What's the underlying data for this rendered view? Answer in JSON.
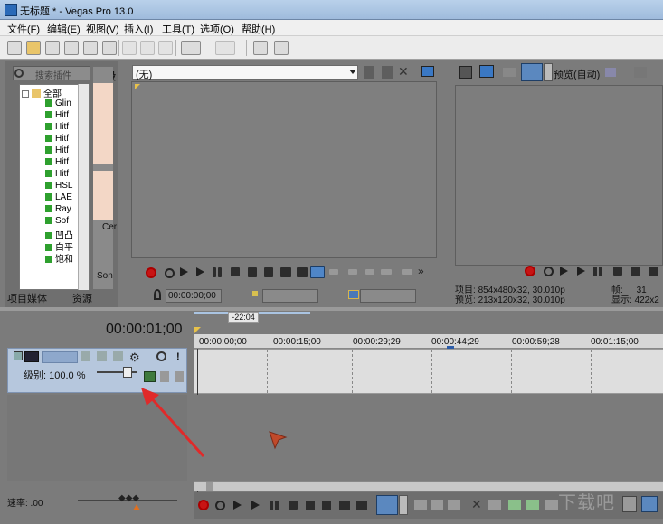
{
  "window": {
    "title": "无标题 * - Vegas Pro 13.0"
  },
  "menu": [
    "文件(F)",
    "编辑(E)",
    "视图(V)",
    "插入(I)",
    "工具(T)",
    "选项(O)",
    "帮助(H)"
  ],
  "explorer": {
    "search_placeholder": "搜索插件",
    "tree_root": "全部",
    "tree_items": [
      "Glin",
      "Hitf",
      "Hitf",
      "Hitf",
      "Hitf",
      "Hitf",
      "Hitf",
      "HSL",
      "LAE",
      "Ray",
      "Sof",
      "凹凸",
      "白平",
      "饱和"
    ],
    "tabs": [
      "项目媒体",
      "资源"
    ],
    "preset_label": "预设",
    "preset_thumbs": [
      "Cer",
      "Son"
    ]
  },
  "trimmer": {
    "dropdown_value": "(无)",
    "timecode": "00:00:00;00"
  },
  "preview": {
    "mode": "预览(自动)",
    "project_label": "项目:",
    "project_value": "854x480x32, 30.010p",
    "preview_label": "预览:",
    "preview_value": "213x120x32, 30.010p",
    "frame_label": "帧:",
    "frame_value": "31",
    "display_label": "显示:",
    "display_value": "422x2"
  },
  "timeline": {
    "timecode": "00:00:01;00",
    "marker": "-22:04",
    "ruler_labels": [
      "00:00:00;00",
      "00:00:15;00",
      "00:00:29;29",
      "00:00:44;29",
      "00:00:59;28",
      "00:01:15;00"
    ],
    "track": {
      "level_label": "级别: 100.0 %"
    },
    "rate_label": "速率: .00"
  },
  "watermark": "下载吧"
}
